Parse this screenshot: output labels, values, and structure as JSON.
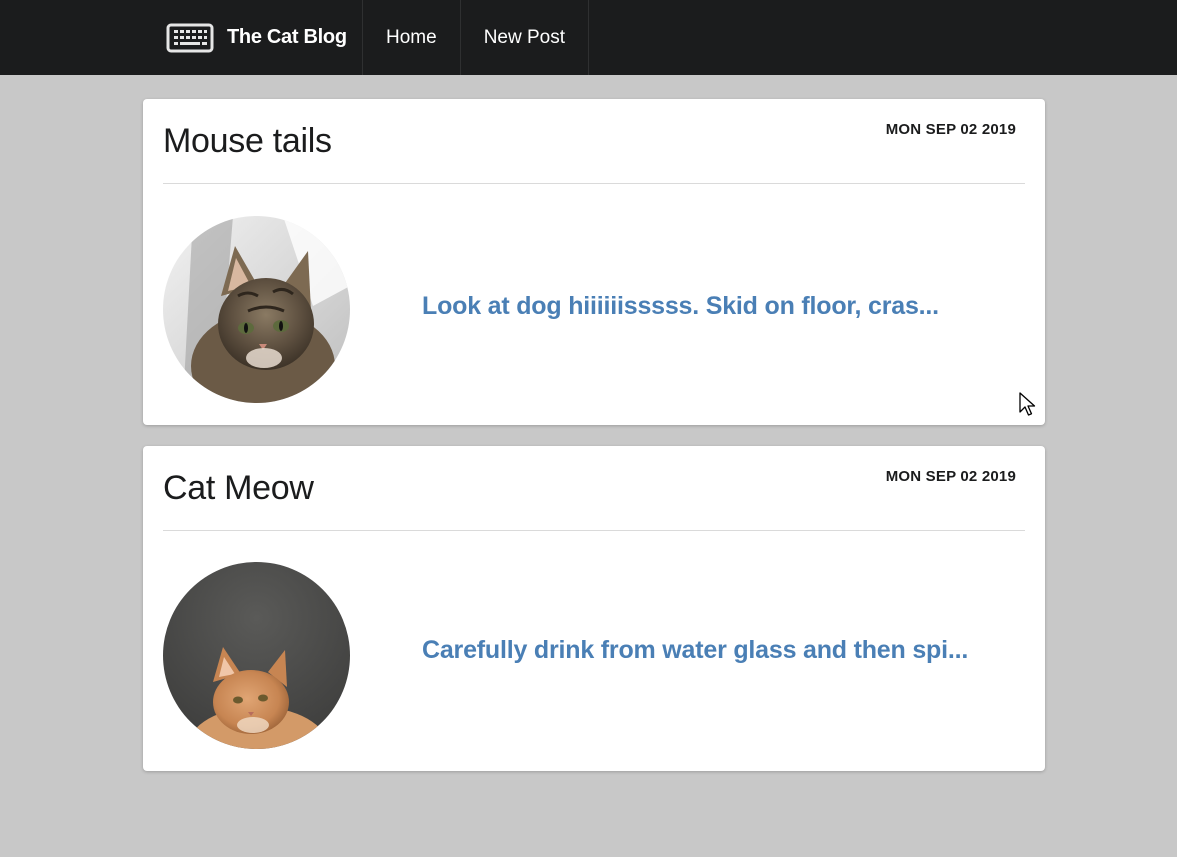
{
  "navbar": {
    "brand": "The Cat Blog",
    "icon": "keyboard-icon",
    "links": [
      "Home",
      "New Post"
    ]
  },
  "posts": [
    {
      "title": "Mouse tails",
      "date": "MON SEP 02 2019",
      "excerpt": "Look at dog hiiiiiisssss. Skid on floor, cras...",
      "image": "tabby-kitten-photo"
    },
    {
      "title": "Cat Meow",
      "date": "MON SEP 02 2019",
      "excerpt": "Carefully drink from water glass and then spi...",
      "image": "orange-cat-photo"
    }
  ],
  "colors": {
    "navbar_bg": "#1b1c1d",
    "page_bg": "#c8c8c8",
    "link_blue": "#4a7fb5"
  }
}
